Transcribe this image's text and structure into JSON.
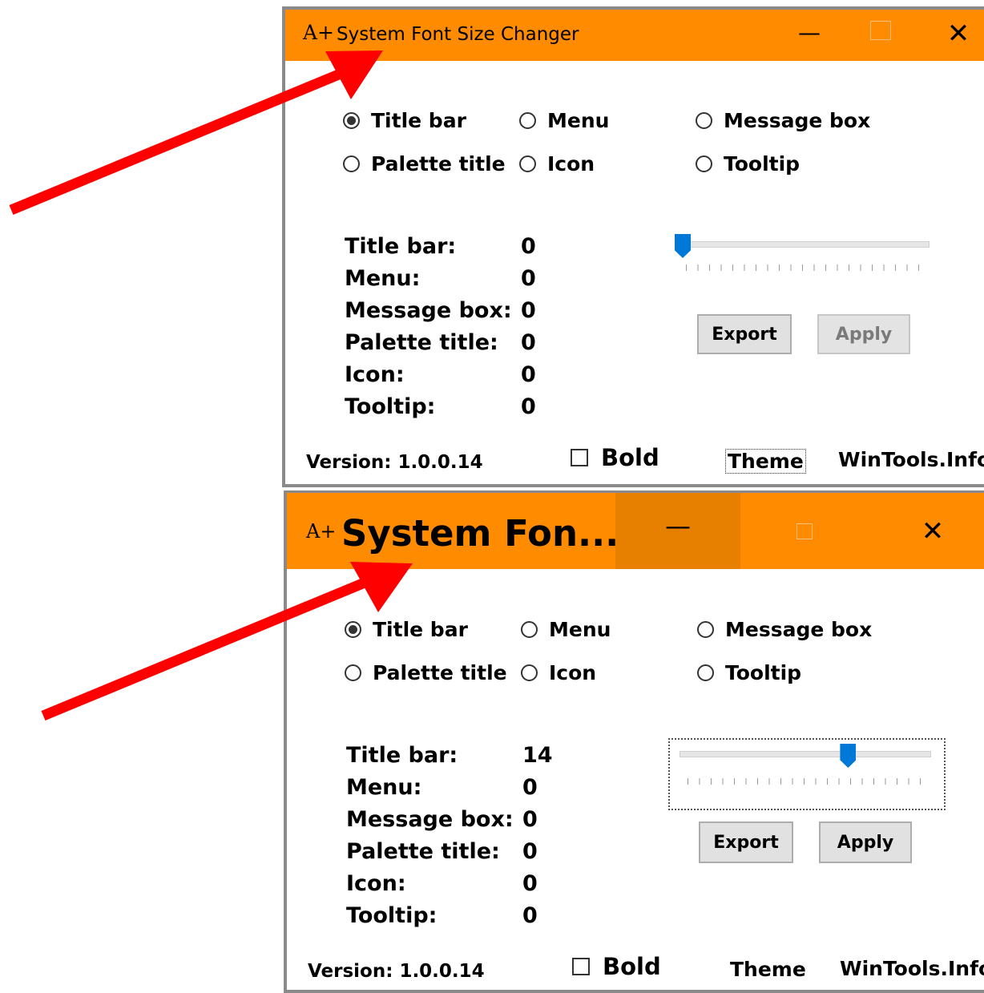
{
  "windows": [
    {
      "app_icon": "A+",
      "title": "System Font Size Changer",
      "controls": {
        "minimize": "—",
        "close": "✕"
      },
      "radios": [
        {
          "label": "Title bar",
          "checked": true
        },
        {
          "label": "Menu",
          "checked": false
        },
        {
          "label": "Message box",
          "checked": false
        },
        {
          "label": "Palette title",
          "checked": false
        },
        {
          "label": "Icon",
          "checked": false
        },
        {
          "label": "Tooltip",
          "checked": false
        }
      ],
      "values": [
        {
          "label": "Title bar:",
          "value": "0"
        },
        {
          "label": "Menu:",
          "value": "0"
        },
        {
          "label": "Message box:",
          "value": "0"
        },
        {
          "label": "Palette title:",
          "value": "0"
        },
        {
          "label": "Icon:",
          "value": "0"
        },
        {
          "label": "Tooltip:",
          "value": "0"
        }
      ],
      "slider_level": 0,
      "export_label": "Export",
      "apply_label": "Apply",
      "apply_enabled": false,
      "version": "Version: 1.0.0.14",
      "bold_label": "Bold",
      "theme_label": "Theme",
      "site_label": "WinTools.Info"
    },
    {
      "app_icon": "A+",
      "title": "System Fon...",
      "controls": {
        "minimize": "—",
        "close": "✕"
      },
      "radios": [
        {
          "label": "Title bar",
          "checked": true
        },
        {
          "label": "Menu",
          "checked": false
        },
        {
          "label": "Message box",
          "checked": false
        },
        {
          "label": "Palette title",
          "checked": false
        },
        {
          "label": "Icon",
          "checked": false
        },
        {
          "label": "Tooltip",
          "checked": false
        }
      ],
      "values": [
        {
          "label": "Title bar:",
          "value": "14"
        },
        {
          "label": "Menu:",
          "value": "0"
        },
        {
          "label": "Message box:",
          "value": "0"
        },
        {
          "label": "Palette title:",
          "value": "0"
        },
        {
          "label": "Icon:",
          "value": "0"
        },
        {
          "label": "Tooltip:",
          "value": "0"
        }
      ],
      "slider_level": 14,
      "export_label": "Export",
      "apply_label": "Apply",
      "apply_enabled": true,
      "version": "Version: 1.0.0.14",
      "bold_label": "Bold",
      "theme_label": "Theme",
      "site_label": "WinTools.Info"
    }
  ],
  "colors": {
    "titlebar": "#ff8c00",
    "slider_thumb": "#0078d7",
    "annotation_arrow": "#ff0000"
  }
}
